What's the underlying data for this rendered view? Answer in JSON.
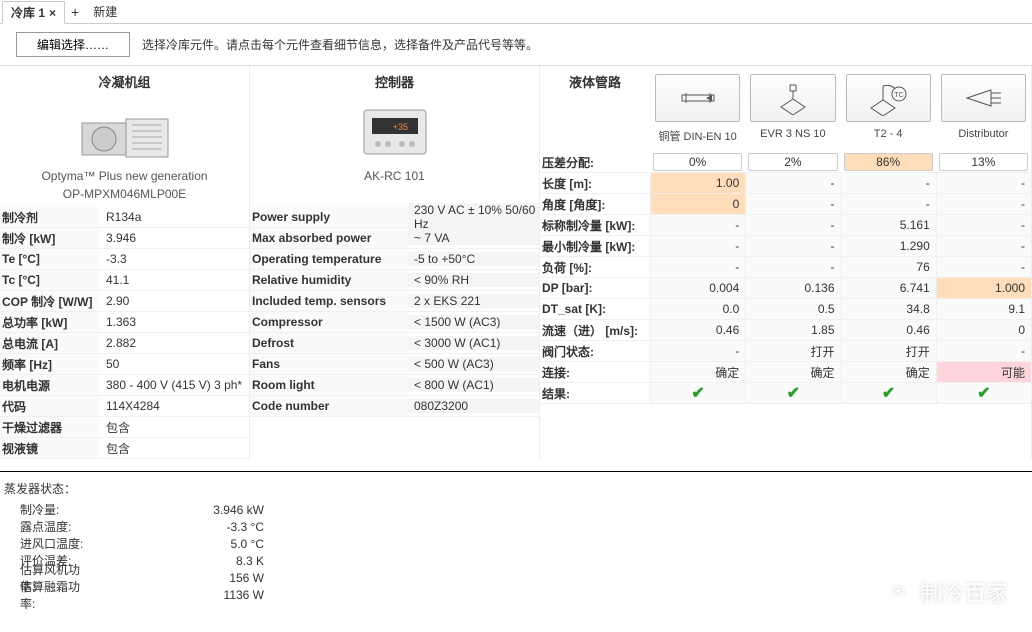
{
  "tabs": {
    "active": "冷库 1",
    "new": "新建"
  },
  "toolbar": {
    "edit": "编辑选择……",
    "hint": "选择冷库元件。请点击每个元件查看细节信息，选择备件及产品代号等等。"
  },
  "col1": {
    "header": "冷凝机组",
    "name": "Optyma™ Plus new generation",
    "code": "OP-MPXM046MLP00E",
    "rows": [
      {
        "label": "制冷剂",
        "val": "R134a"
      },
      {
        "label": "制冷 [kW]",
        "val": "3.946"
      },
      {
        "label": "Te [°C]",
        "val": "-3.3"
      },
      {
        "label": "Tc [°C]",
        "val": "41.1"
      },
      {
        "label": "COP 制冷 [W/W]",
        "val": "2.90"
      },
      {
        "label": "总功率 [kW]",
        "val": "1.363"
      },
      {
        "label": "总电流 [A]",
        "val": "2.882"
      },
      {
        "label": "频率 [Hz]",
        "val": "50"
      },
      {
        "label": "电机电源",
        "val": "380 - 400 V (415 V) 3 ph*"
      },
      {
        "label": "代码",
        "val": "114X4284"
      },
      {
        "label": "干燥过滤器",
        "val": "包含"
      },
      {
        "label": "视液镜",
        "val": "包含"
      }
    ]
  },
  "col2": {
    "header": "控制器",
    "name": "AK-RC 101",
    "rows": [
      {
        "label": "Power supply",
        "val": "230 V AC ± 10% 50/60 Hz"
      },
      {
        "label": "Max absorbed power",
        "val": "~ 7 VA"
      },
      {
        "label": "Operating temperature",
        "val": "-5 to +50°C"
      },
      {
        "label": "Relative humidity",
        "val": "< 90% RH"
      },
      {
        "label": "Included temp. sensors",
        "val": "2 x EKS 221"
      },
      {
        "label": "Compressor",
        "val": "< 1500 W (AC3)"
      },
      {
        "label": "Defrost",
        "val": "< 3000 W (AC1)"
      },
      {
        "label": "Fans",
        "val": "< 500 W (AC3)"
      },
      {
        "label": "Room light",
        "val": "< 800 W (AC1)"
      },
      {
        "label": "Code number",
        "val": "080Z3200"
      }
    ]
  },
  "col3": {
    "header": "液体管路",
    "components": [
      {
        "name": "pipe",
        "label": "铜管 DIN-EN 10"
      },
      {
        "name": "valve",
        "label": "EVR 3 NS 10"
      },
      {
        "name": "txv",
        "label": "T2 - 4"
      },
      {
        "name": "distributor",
        "label": "Distributor"
      }
    ],
    "rows": [
      {
        "label": "压差分配:",
        "cells": [
          {
            "v": "0%",
            "box": true
          },
          {
            "v": "2%",
            "box": true
          },
          {
            "v": "86%",
            "box": true,
            "orange": true
          },
          {
            "v": "13%",
            "box": true
          }
        ]
      },
      {
        "label": "长度 [m]:",
        "cells": [
          {
            "v": "1.00",
            "orange": true
          },
          {
            "v": "-"
          },
          {
            "v": "-"
          },
          {
            "v": "-"
          }
        ]
      },
      {
        "label": "角度 [角度]:",
        "cells": [
          {
            "v": "0",
            "orange": true
          },
          {
            "v": "-"
          },
          {
            "v": "-"
          },
          {
            "v": "-"
          }
        ]
      },
      {
        "label": "标称制冷量 [kW]:",
        "cells": [
          {
            "v": "-"
          },
          {
            "v": "-"
          },
          {
            "v": "5.161"
          },
          {
            "v": "-"
          }
        ]
      },
      {
        "label": "最小制冷量 [kW]:",
        "cells": [
          {
            "v": "-"
          },
          {
            "v": "-"
          },
          {
            "v": "1.290"
          },
          {
            "v": "-"
          }
        ]
      },
      {
        "label": "负荷 [%]:",
        "cells": [
          {
            "v": "-"
          },
          {
            "v": "-"
          },
          {
            "v": "76"
          },
          {
            "v": "-"
          }
        ]
      },
      {
        "label": "DP [bar]:",
        "cells": [
          {
            "v": "0.004"
          },
          {
            "v": "0.136"
          },
          {
            "v": "6.741"
          },
          {
            "v": "1.000",
            "orange": true
          }
        ]
      },
      {
        "label": "DT_sat [K]:",
        "cells": [
          {
            "v": "0.0"
          },
          {
            "v": "0.5"
          },
          {
            "v": "34.8"
          },
          {
            "v": "9.1"
          }
        ]
      },
      {
        "label": "流速（进） [m/s]:",
        "cells": [
          {
            "v": "0.46"
          },
          {
            "v": "1.85"
          },
          {
            "v": "0.46"
          },
          {
            "v": "0"
          }
        ]
      },
      {
        "label": "阀门状态:",
        "cells": [
          {
            "v": "-"
          },
          {
            "v": "打开"
          },
          {
            "v": "打开"
          },
          {
            "v": "-"
          }
        ]
      },
      {
        "label": "连接:",
        "cells": [
          {
            "v": "确定"
          },
          {
            "v": "确定"
          },
          {
            "v": "确定"
          },
          {
            "v": "可能",
            "pink": true
          }
        ]
      },
      {
        "label": "结果:",
        "cells": [
          {
            "v": "check"
          },
          {
            "v": "check"
          },
          {
            "v": "check"
          },
          {
            "v": "check"
          }
        ]
      }
    ]
  },
  "status": {
    "title": "蒸发器状态：",
    "rows": [
      {
        "label": "制冷量:",
        "val": "3.946 kW"
      },
      {
        "label": "露点温度:",
        "val": "-3.3 °C"
      },
      {
        "label": "进风口温度:",
        "val": "5.0 °C"
      },
      {
        "label": "评价温差:",
        "val": "8.3 K"
      },
      {
        "label": "估算风机功率:",
        "val": "156 W"
      },
      {
        "label": "估算融霜功率:",
        "val": "1136 W"
      }
    ]
  },
  "watermark": "制冷百家"
}
